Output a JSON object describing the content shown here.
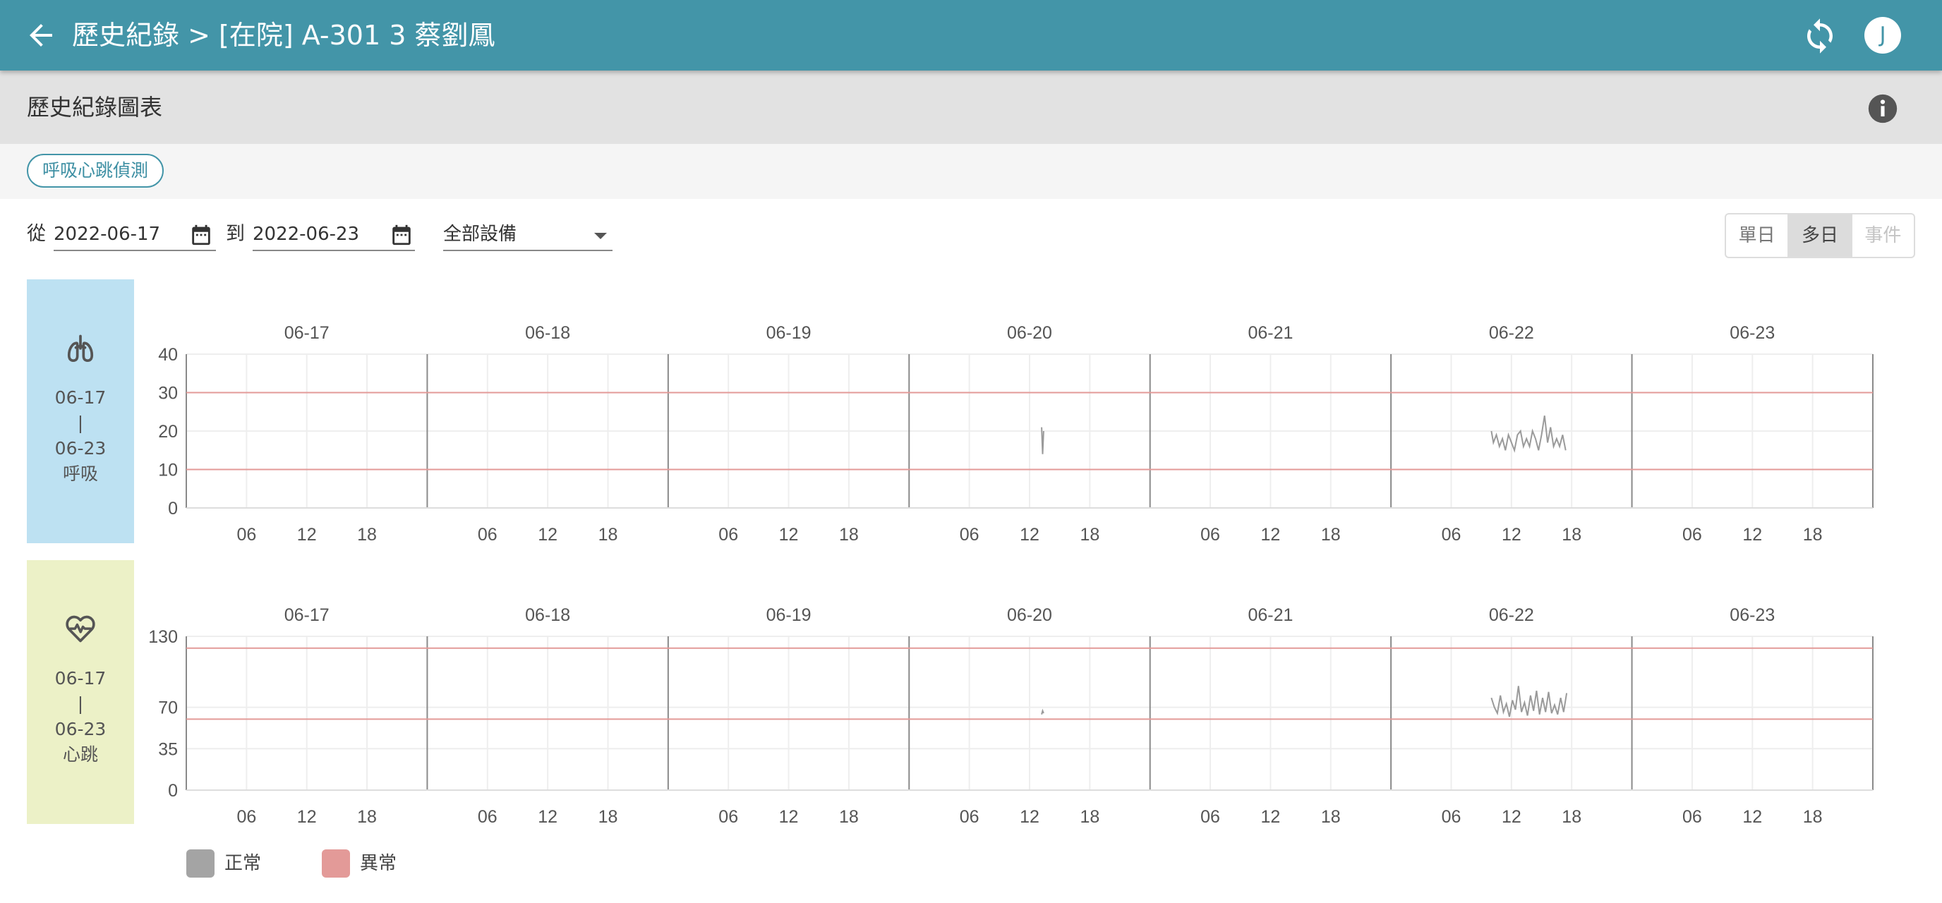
{
  "header": {
    "title": "歷史紀錄 > [在院] A-301 3 蔡劉鳳",
    "avatar_initial": "J",
    "back_icon": "arrow-left-icon",
    "refresh_icon": "refresh-icon"
  },
  "subheader": {
    "title": "歷史紀錄圖表",
    "info_icon": "info-icon"
  },
  "chips": [
    "呼吸心跳偵測"
  ],
  "filters": {
    "from_label": "從",
    "from_date": "2022-06-17",
    "to_label": "到",
    "to_date": "2022-06-23",
    "device_select": "全部設備",
    "view_modes": [
      {
        "label": "單日",
        "state": "normal"
      },
      {
        "label": "多日",
        "state": "active"
      },
      {
        "label": "事件",
        "state": "disabled"
      }
    ]
  },
  "panels": [
    {
      "icon": "lungs-icon",
      "start": "06-17",
      "sep": "|",
      "end": "06-23",
      "label": "呼吸",
      "color": "#bde1f2"
    },
    {
      "icon": "heart-pulse-icon",
      "start": "06-17",
      "sep": "|",
      "end": "06-23",
      "label": "心跳",
      "color": "#ecf1c7"
    }
  ],
  "legend": [
    {
      "label": "正常",
      "color": "#a4a4a4"
    },
    {
      "label": "異常",
      "color": "#e39a98"
    }
  ],
  "chart_data": [
    {
      "type": "line",
      "title": "",
      "days": [
        "06-17",
        "06-18",
        "06-19",
        "06-20",
        "06-21",
        "06-22",
        "06-23"
      ],
      "hour_ticks": [
        "06",
        "12",
        "18"
      ],
      "y_ticks": [
        0,
        10,
        20,
        30,
        40
      ],
      "ylim": [
        0,
        40
      ],
      "thresholds": [
        10,
        30
      ],
      "threshold_color": "#e39a98",
      "grid": true,
      "series": [
        {
          "day": "06-20",
          "points": [
            [
              13.2,
              21
            ],
            [
              13.3,
              14
            ],
            [
              13.4,
              20
            ]
          ]
        },
        {
          "day": "06-22",
          "points": [
            [
              10.0,
              20
            ],
            [
              10.2,
              17
            ],
            [
              10.5,
              19
            ],
            [
              10.8,
              16
            ],
            [
              11.1,
              18
            ],
            [
              11.4,
              15
            ],
            [
              11.7,
              19
            ],
            [
              12.0,
              17
            ],
            [
              12.3,
              15
            ],
            [
              12.6,
              19
            ],
            [
              12.9,
              20
            ],
            [
              13.2,
              16
            ],
            [
              13.5,
              18
            ],
            [
              13.8,
              16
            ],
            [
              14.1,
              20
            ],
            [
              14.4,
              18
            ],
            [
              14.7,
              15
            ],
            [
              15.0,
              19
            ],
            [
              15.3,
              24
            ],
            [
              15.6,
              17
            ],
            [
              15.9,
              21
            ],
            [
              16.2,
              16
            ],
            [
              16.5,
              18
            ],
            [
              16.8,
              16
            ],
            [
              17.1,
              19
            ],
            [
              17.4,
              15
            ]
          ]
        }
      ]
    },
    {
      "type": "line",
      "title": "",
      "days": [
        "06-17",
        "06-18",
        "06-19",
        "06-20",
        "06-21",
        "06-22",
        "06-23"
      ],
      "hour_ticks": [
        "06",
        "12",
        "18"
      ],
      "y_ticks": [
        0,
        35,
        70,
        130
      ],
      "ylim": [
        0,
        130
      ],
      "thresholds": [
        60,
        120
      ],
      "threshold_color": "#e39a98",
      "grid": true,
      "series": [
        {
          "day": "06-20",
          "points": [
            [
              13.2,
              64
            ],
            [
              13.3,
              67
            ],
            [
              13.4,
              65
            ]
          ]
        },
        {
          "day": "06-22",
          "points": [
            [
              10.0,
              78
            ],
            [
              10.3,
              70
            ],
            [
              10.6,
              65
            ],
            [
              10.9,
              80
            ],
            [
              11.2,
              66
            ],
            [
              11.5,
              73
            ],
            [
              11.8,
              62
            ],
            [
              12.1,
              76
            ],
            [
              12.4,
              68
            ],
            [
              12.7,
              88
            ],
            [
              13.0,
              66
            ],
            [
              13.3,
              74
            ],
            [
              13.6,
              63
            ],
            [
              13.9,
              80
            ],
            [
              14.2,
              67
            ],
            [
              14.5,
              84
            ],
            [
              14.8,
              64
            ],
            [
              15.1,
              78
            ],
            [
              15.4,
              66
            ],
            [
              15.7,
              83
            ],
            [
              16.0,
              65
            ],
            [
              16.3,
              72
            ],
            [
              16.6,
              64
            ],
            [
              16.9,
              78
            ],
            [
              17.2,
              66
            ],
            [
              17.5,
              82
            ]
          ]
        }
      ]
    }
  ]
}
